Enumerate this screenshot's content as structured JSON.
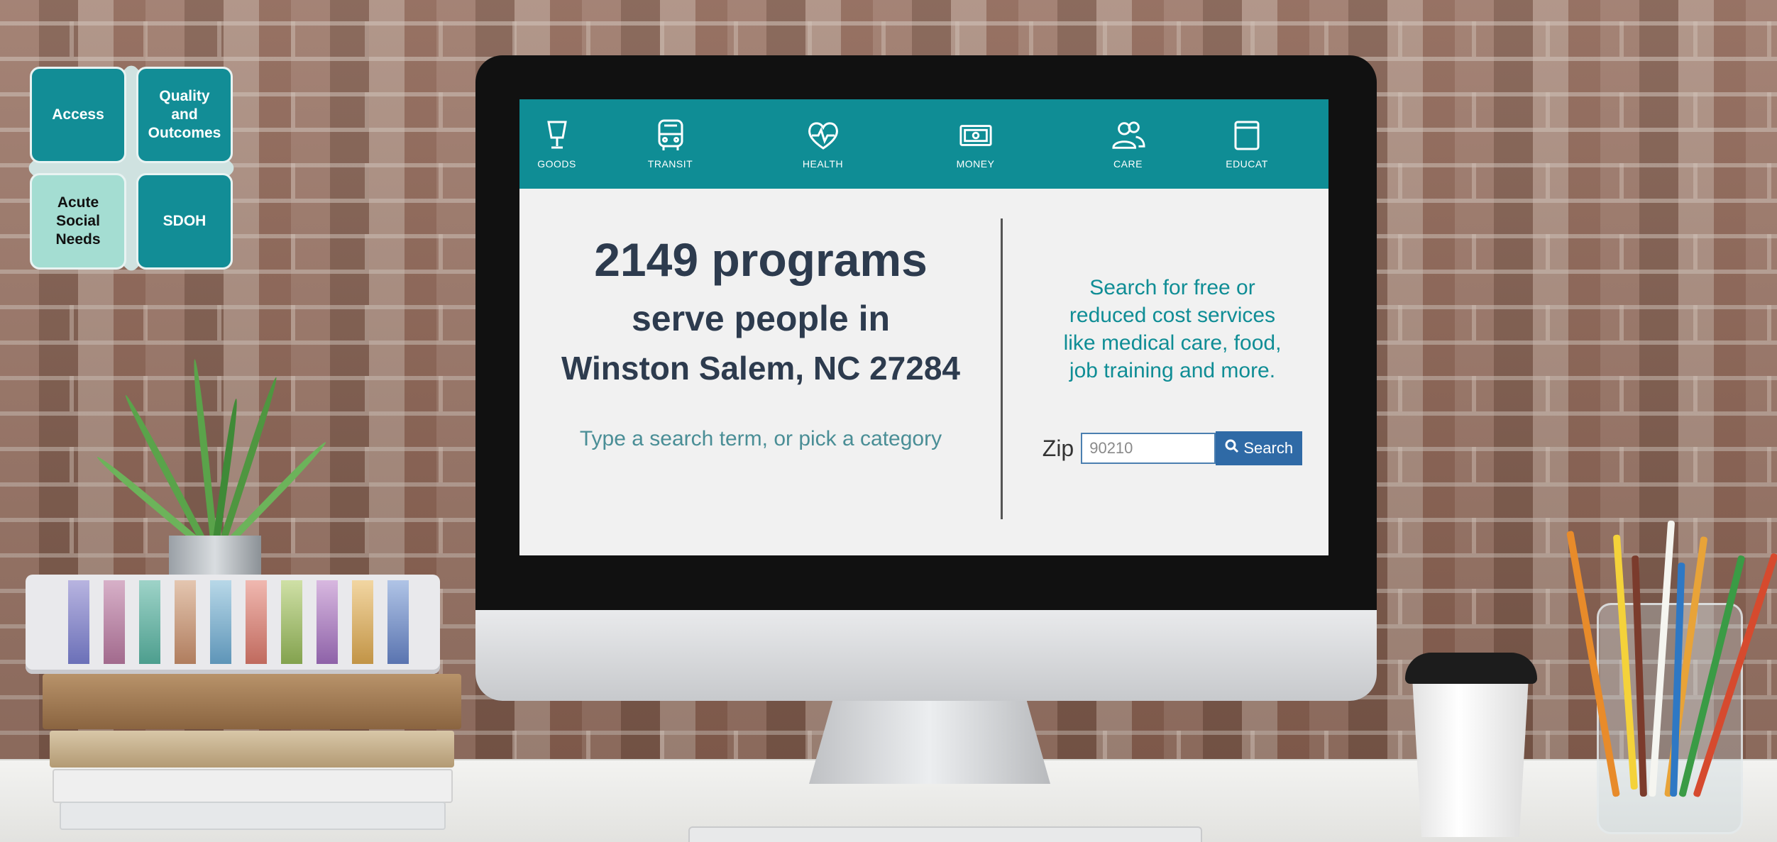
{
  "diagram": {
    "tiles": [
      "Access",
      "Quality and Outcomes",
      "Acute Social Needs",
      "SDOH"
    ]
  },
  "nav": {
    "items": [
      {
        "label": "GOODS",
        "icon": "lamp-icon"
      },
      {
        "label": "TRANSIT",
        "icon": "bus-icon"
      },
      {
        "label": "HEALTH",
        "icon": "heart-pulse-icon"
      },
      {
        "label": "MONEY",
        "icon": "cash-icon"
      },
      {
        "label": "CARE",
        "icon": "people-icon"
      },
      {
        "label": "EDUCAT",
        "icon": "book-icon"
      }
    ]
  },
  "hero": {
    "count": "2149 programs",
    "serve": "serve people in",
    "city": "Winston Salem, NC 27284",
    "hint": "Type a search term, or pick a category"
  },
  "search": {
    "blurb_lines": [
      "Search for free or",
      "reduced cost services",
      "like medical care, food,",
      "job training and more."
    ],
    "zip_label": "Zip",
    "zip_placeholder": "90210",
    "button_label": "Search",
    "button_icon": "search-icon"
  },
  "colors": {
    "teal": "#0f8d95",
    "light_teal": "#a4ddd2",
    "button_blue": "#2f6aa6",
    "heading_dark": "#2d3b4e"
  }
}
